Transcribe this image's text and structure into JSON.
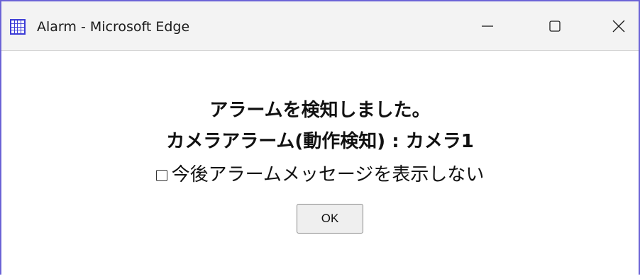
{
  "window": {
    "title": "Alarm - Microsoft Edge",
    "controls": {
      "minimize": "minimize-icon",
      "maximize": "maximize-icon",
      "close": "close-icon"
    },
    "accent_color": "#6b63d6",
    "app_icon": "grid-app-icon",
    "app_icon_color": "#3c3cd6"
  },
  "dialog": {
    "message_line1": "アラームを検知しました。",
    "message_line2": "カメラアラーム(動作検知) : カメラ1",
    "checkbox_label": "今後アラームメッセージを表示しない",
    "checkbox_checked": false,
    "ok_label": "OK"
  }
}
